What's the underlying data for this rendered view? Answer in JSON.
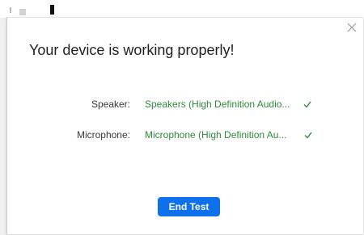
{
  "dialog": {
    "title": "Your device is working properly!",
    "close_icon": "close-icon",
    "speaker": {
      "label": "Speaker:",
      "value": "Speakers (High Definition Audio...",
      "status_icon": "checkmark-icon"
    },
    "microphone": {
      "label": "Microphone:",
      "value": "Microphone (High Definition Au...",
      "status_icon": "checkmark-icon"
    },
    "end_button_label": "End Test"
  },
  "colors": {
    "accent": "#0e71eb",
    "success": "#2e8b3a"
  }
}
